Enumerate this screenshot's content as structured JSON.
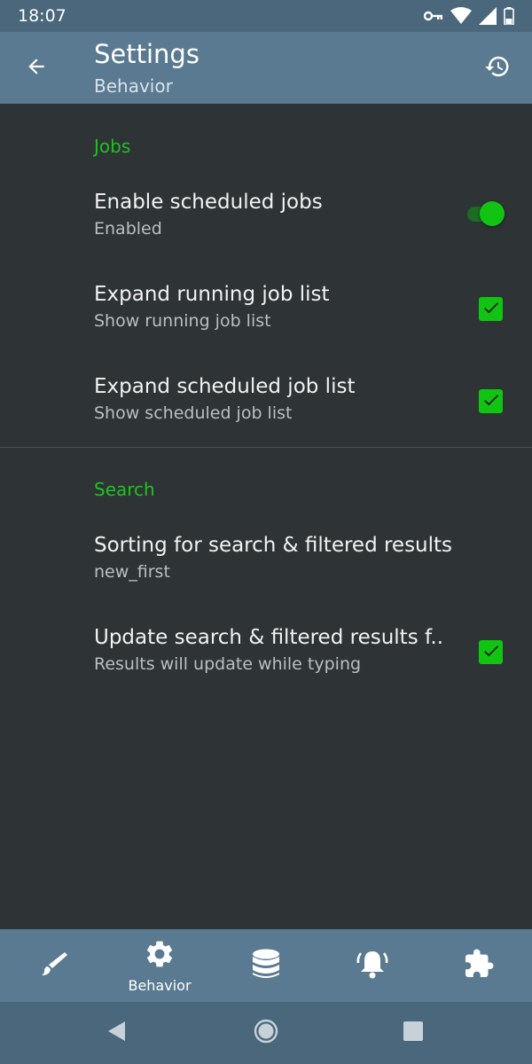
{
  "status_bar": {
    "time": "18:07",
    "icons": [
      "vpn-key-icon",
      "wifi-icon",
      "signal-icon",
      "battery-icon"
    ]
  },
  "app_bar": {
    "title": "Settings",
    "subtitle": "Behavior",
    "left_icon": "back-arrow-icon",
    "right_icon": "history-icon"
  },
  "sections": [
    {
      "header": "Jobs",
      "items": [
        {
          "title": "Enable scheduled jobs",
          "summary": "Enabled",
          "control": "switch",
          "checked": true
        },
        {
          "title": "Expand running job list",
          "summary": "Show running job list",
          "control": "checkbox",
          "checked": true
        },
        {
          "title": "Expand scheduled job list",
          "summary": "Show scheduled job list",
          "control": "checkbox",
          "checked": true
        }
      ]
    },
    {
      "header": "Search",
      "items": [
        {
          "title": "Sorting for search & filtered results",
          "summary": "new_first",
          "control": "none"
        },
        {
          "title": "Update search & filtered results f..",
          "summary": "Results will update while typing",
          "control": "checkbox",
          "checked": true
        }
      ]
    }
  ],
  "bottom_nav": [
    {
      "icon": "brush-icon",
      "label": "",
      "active": false
    },
    {
      "icon": "gear-icon",
      "label": "Behavior",
      "active": true
    },
    {
      "icon": "database-icon",
      "label": "",
      "active": false
    },
    {
      "icon": "bell-icon",
      "label": "",
      "active": false
    },
    {
      "icon": "puzzle-icon",
      "label": "",
      "active": false
    }
  ],
  "system_nav": [
    "back-triangle-icon",
    "home-circle-icon",
    "recents-square-icon"
  ],
  "colors": {
    "accent_green": "#12c412",
    "section_header": "#1fc21f",
    "app_bar": "#5a7a91",
    "status_bar": "#4a677c",
    "background": "#2e3335"
  }
}
